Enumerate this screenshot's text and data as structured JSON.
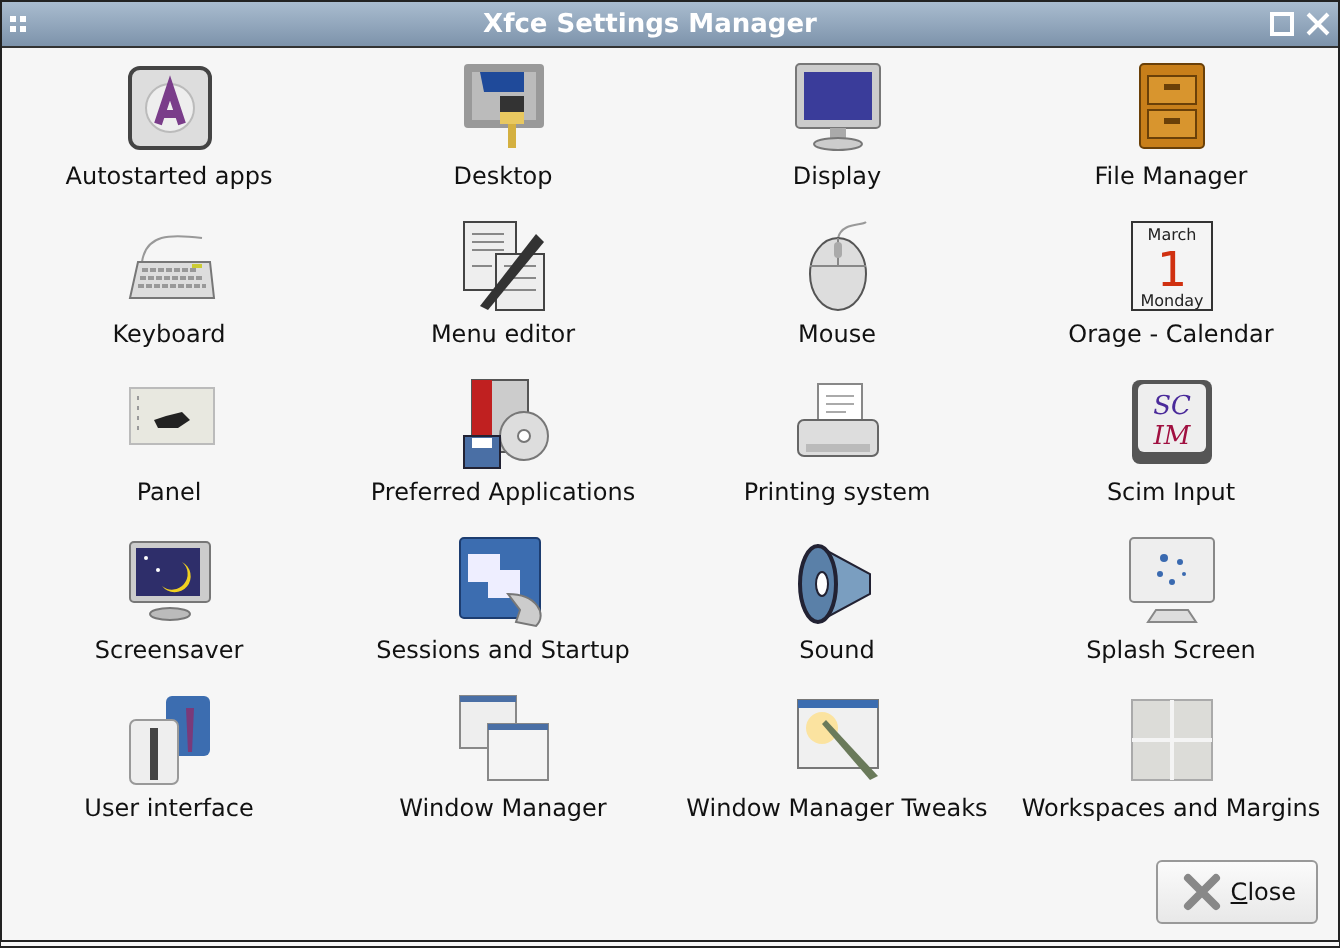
{
  "window": {
    "title": "Xfce Settings Manager"
  },
  "items": [
    {
      "label": "Autostarted apps",
      "kind": "autostart"
    },
    {
      "label": "Desktop",
      "kind": "desktop"
    },
    {
      "label": "Display",
      "kind": "display"
    },
    {
      "label": "File Manager",
      "kind": "filemanager"
    },
    {
      "label": "Keyboard",
      "kind": "keyboard"
    },
    {
      "label": "Menu editor",
      "kind": "menueditor"
    },
    {
      "label": "Mouse",
      "kind": "mouse"
    },
    {
      "label": "Orage - Calendar",
      "kind": "calendar",
      "icon_text": [
        "March",
        "1",
        "Monday"
      ]
    },
    {
      "label": "Panel",
      "kind": "panel"
    },
    {
      "label": "Preferred Applications",
      "kind": "preferred"
    },
    {
      "label": "Printing system",
      "kind": "printer"
    },
    {
      "label": "Scim Input",
      "kind": "scim",
      "icon_text": [
        "SC",
        "IM"
      ]
    },
    {
      "label": "Screensaver",
      "kind": "screensaver"
    },
    {
      "label": "Sessions and Startup",
      "kind": "sessions"
    },
    {
      "label": "Sound",
      "kind": "sound"
    },
    {
      "label": "Splash Screen",
      "kind": "splash"
    },
    {
      "label": "User interface",
      "kind": "userinterface"
    },
    {
      "label": "Window Manager",
      "kind": "windowmanager"
    },
    {
      "label": "Window Manager Tweaks",
      "kind": "tweaks"
    },
    {
      "label": "Workspaces and Margins",
      "kind": "workspaces"
    }
  ],
  "close_button": {
    "label": "Close",
    "mnemonic": true
  }
}
